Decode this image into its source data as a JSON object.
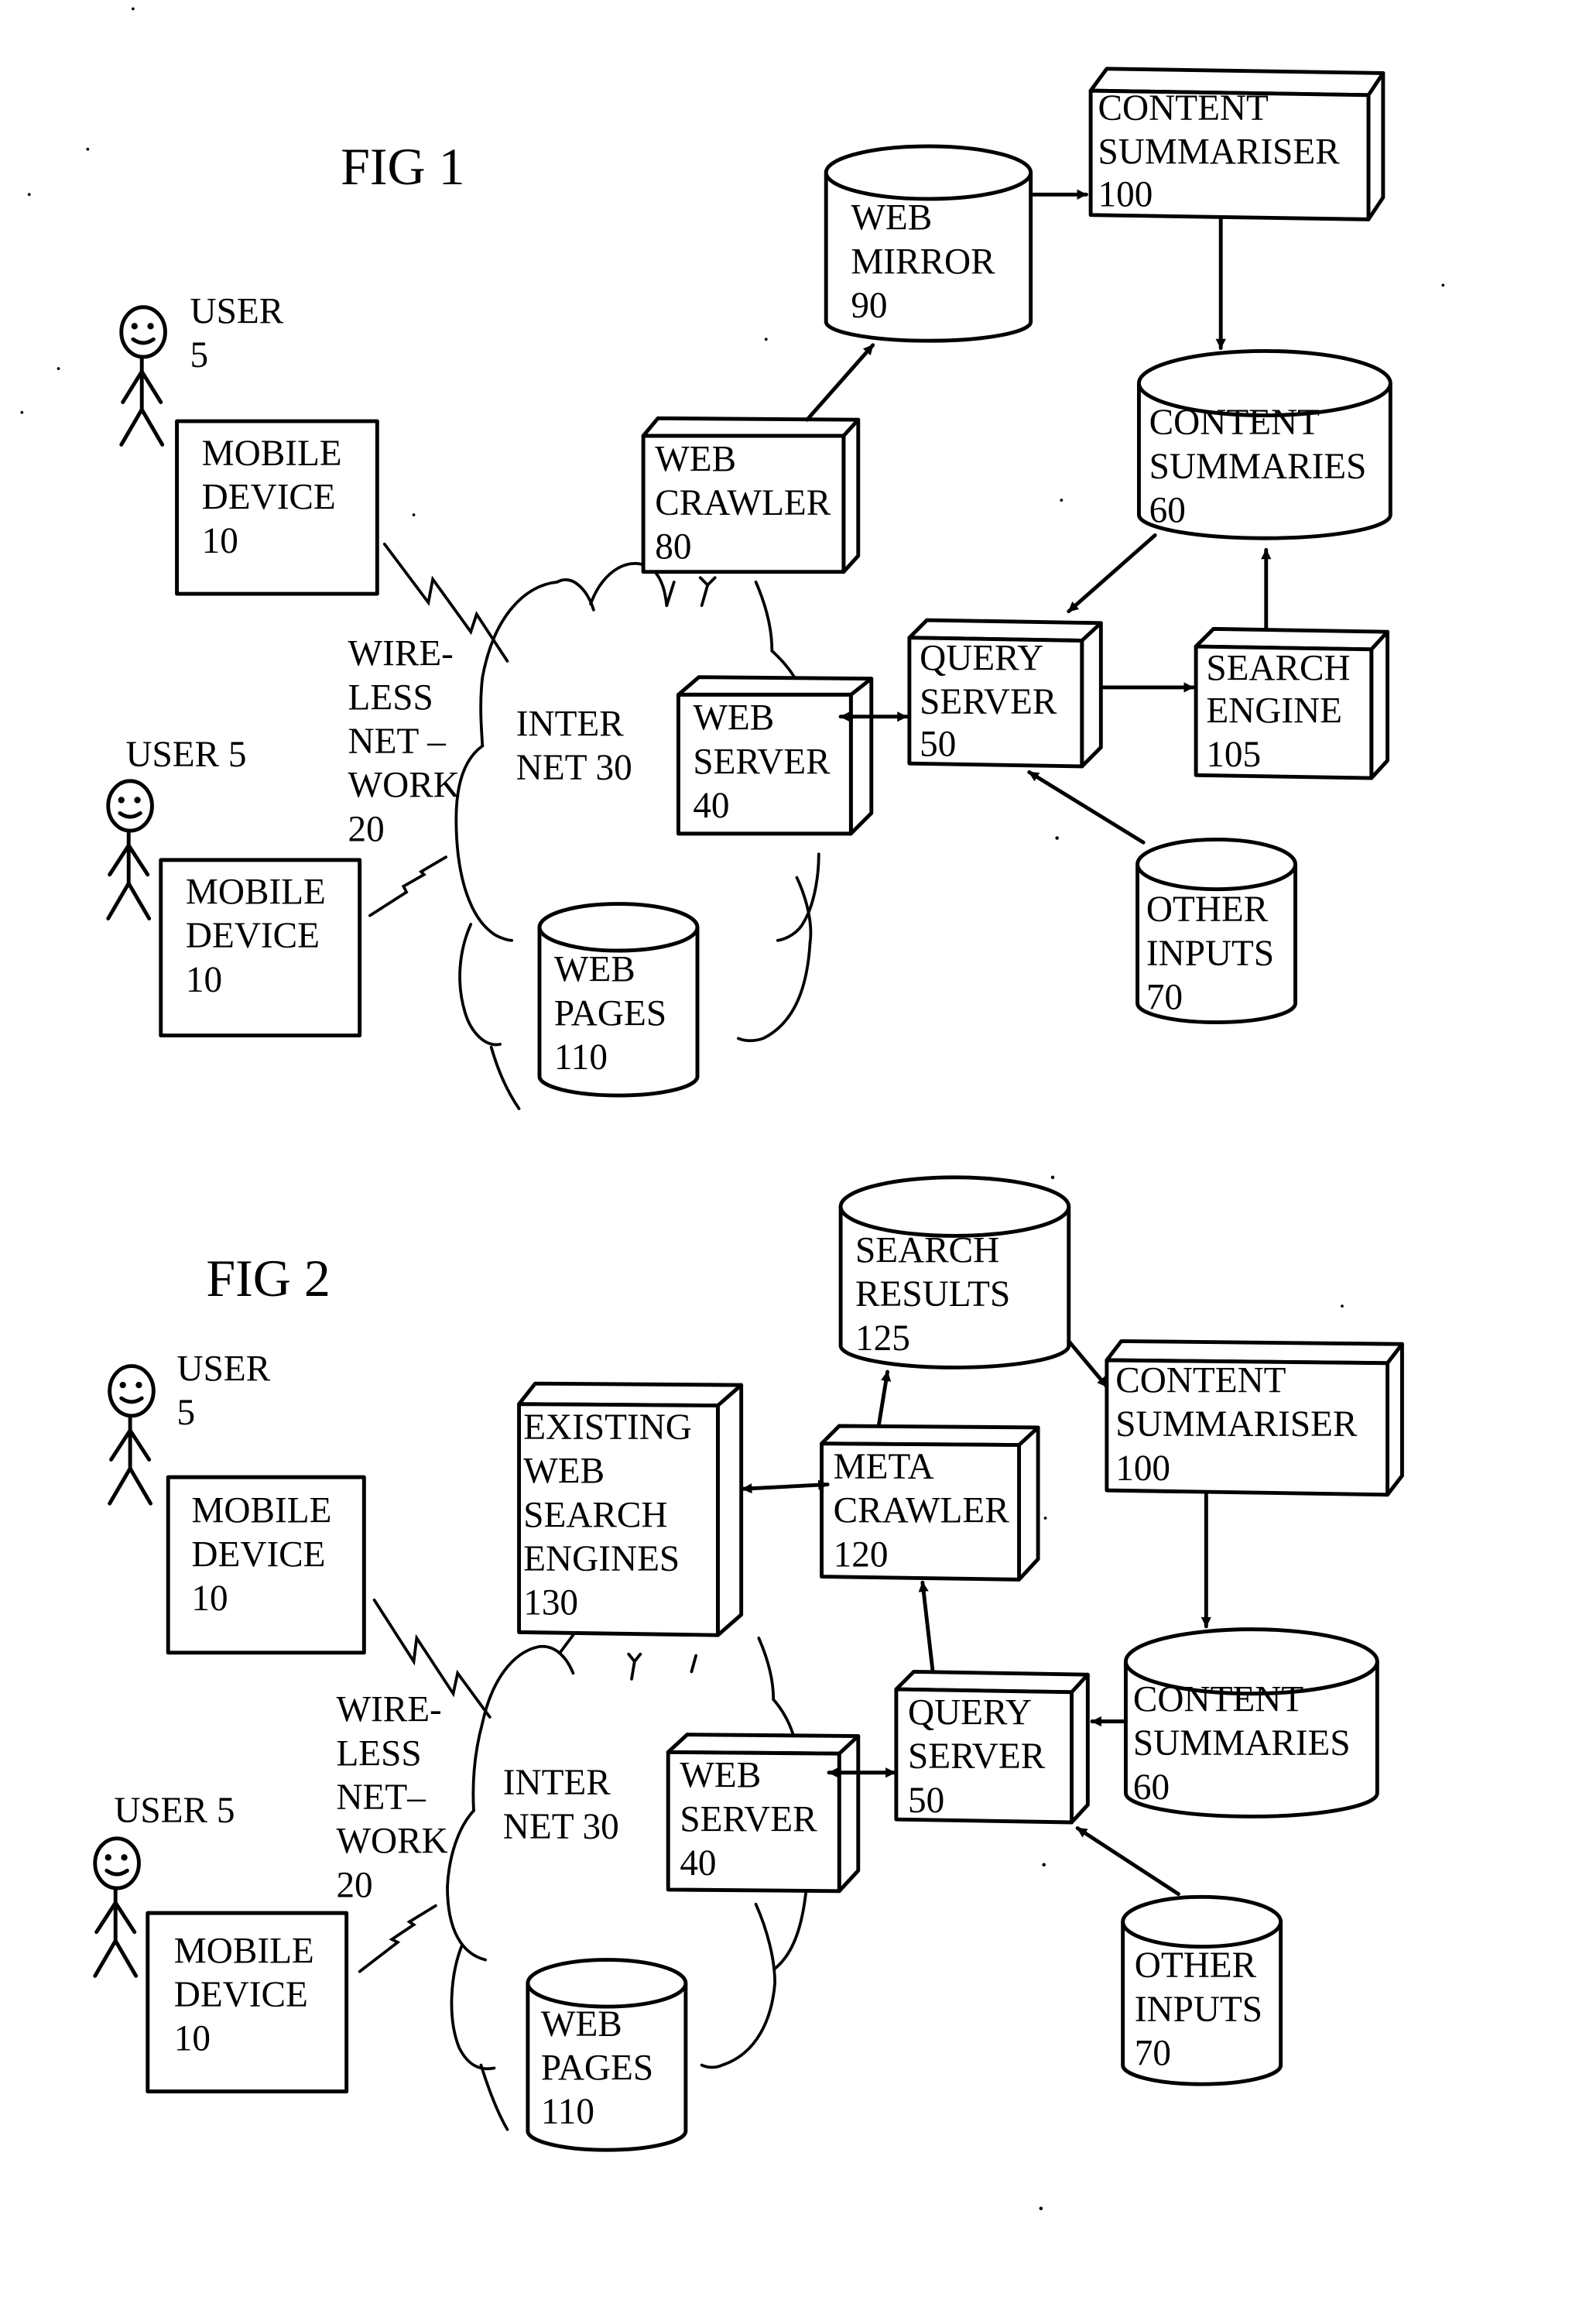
{
  "figures": [
    {
      "title": "FIG 1",
      "users": [
        {
          "label_lines": [
            "USER",
            "5"
          ]
        },
        {
          "label_lines": [
            "USER 5"
          ]
        }
      ],
      "mobile_devices": [
        {
          "label_lines": [
            "MOBILE",
            "DEVICE",
            "10"
          ]
        },
        {
          "label_lines": [
            "MOBILE",
            "DEVICE",
            "10"
          ]
        }
      ],
      "wireless_network": {
        "label_lines": [
          "WIRE-",
          "LESS",
          "NET –",
          "WORK",
          "20"
        ]
      },
      "internet": {
        "label_lines": [
          "INTER",
          "NET 30"
        ]
      },
      "web_server": {
        "label_lines": [
          "WEB",
          "SERVER",
          "40"
        ]
      },
      "web_pages": {
        "label_lines": [
          "WEB",
          "PAGES",
          "110"
        ]
      },
      "web_crawler": {
        "label_lines": [
          "WEB",
          "CRAWLER",
          "80"
        ]
      },
      "web_mirror": {
        "label_lines": [
          "WEB",
          "MIRROR",
          "90"
        ]
      },
      "content_summariser": {
        "label_lines": [
          "CONTENT",
          "SUMMARISER",
          "100"
        ]
      },
      "content_summaries": {
        "label_lines": [
          "CONTENT",
          "SUMMARIES",
          "60"
        ]
      },
      "query_server": {
        "label_lines": [
          "QUERY",
          "SERVER",
          "50"
        ]
      },
      "search_engine": {
        "label_lines": [
          "SEARCH",
          "ENGINE",
          "105"
        ]
      },
      "other_inputs": {
        "label_lines": [
          "OTHER",
          "INPUTS",
          "70"
        ]
      },
      "connections": [
        {
          "from": "WEB SERVER 40",
          "to": "QUERY SERVER 50",
          "direction": "bidirectional"
        },
        {
          "from": "WEB CRAWLER 80",
          "to": "WEB MIRROR 90",
          "direction": "forward"
        },
        {
          "from": "WEB MIRROR 90",
          "to": "CONTENT SUMMARISER 100",
          "direction": "forward"
        },
        {
          "from": "CONTENT SUMMARISER 100",
          "to": "CONTENT SUMMARIES 60",
          "direction": "forward"
        },
        {
          "from": "CONTENT SUMMARIES 60",
          "to": "QUERY SERVER 50",
          "direction": "forward"
        },
        {
          "from": "QUERY SERVER 50",
          "to": "SEARCH ENGINE 105",
          "direction": "forward"
        },
        {
          "from": "SEARCH ENGINE 105",
          "to": "CONTENT SUMMARIES 60",
          "direction": "forward"
        },
        {
          "from": "OTHER INPUTS 70",
          "to": "QUERY SERVER 50",
          "direction": "forward"
        },
        {
          "from": "MOBILE DEVICE 10",
          "to": "INTERNET 30",
          "direction": "wireless"
        },
        {
          "from": "MOBILE DEVICE 10",
          "to": "INTERNET 30",
          "direction": "wireless"
        }
      ]
    },
    {
      "title": "FIG 2",
      "users": [
        {
          "label_lines": [
            "USER",
            "5"
          ]
        },
        {
          "label_lines": [
            "USER 5"
          ]
        }
      ],
      "mobile_devices": [
        {
          "label_lines": [
            "MOBILE",
            "DEVICE",
            "10"
          ]
        },
        {
          "label_lines": [
            "MOBILE",
            "DEVICE",
            "10"
          ]
        }
      ],
      "wireless_network": {
        "label_lines": [
          "WIRE-",
          "LESS",
          "NET–",
          "WORK",
          "20"
        ]
      },
      "internet": {
        "label_lines": [
          "INTER",
          "NET 30"
        ]
      },
      "web_server": {
        "label_lines": [
          "WEB",
          "SERVER",
          "40"
        ]
      },
      "web_pages": {
        "label_lines": [
          "WEB",
          "PAGES",
          "110"
        ]
      },
      "existing_search_engines": {
        "label_lines": [
          "EXISTING",
          "WEB",
          "SEARCH",
          "ENGINES",
          "130"
        ]
      },
      "meta_crawler": {
        "label_lines": [
          "META",
          "CRAWLER",
          "120"
        ]
      },
      "search_results": {
        "label_lines": [
          "SEARCH",
          "RESULTS",
          "125"
        ]
      },
      "content_summariser": {
        "label_lines": [
          "CONTENT",
          "SUMMARISER",
          "100"
        ]
      },
      "content_summaries": {
        "label_lines": [
          "CONTENT",
          "SUMMARIES",
          "60"
        ]
      },
      "query_server": {
        "label_lines": [
          "QUERY",
          "SERVER",
          "50"
        ]
      },
      "other_inputs": {
        "label_lines": [
          "OTHER",
          "INPUTS",
          "70"
        ]
      },
      "connections": [
        {
          "from": "WEB SERVER 40",
          "to": "QUERY SERVER 50",
          "direction": "bidirectional"
        },
        {
          "from": "QUERY SERVER 50",
          "to": "META CRAWLER 120",
          "direction": "forward"
        },
        {
          "from": "EXISTING WEB SEARCH ENGINES 130",
          "to": "META CRAWLER 120",
          "direction": "bidirectional"
        },
        {
          "from": "META CRAWLER 120",
          "to": "SEARCH RESULTS 125",
          "direction": "forward"
        },
        {
          "from": "SEARCH RESULTS 125",
          "to": "CONTENT SUMMARISER 100",
          "direction": "forward"
        },
        {
          "from": "CONTENT SUMMARISER 100",
          "to": "CONTENT SUMMARIES 60",
          "direction": "forward"
        },
        {
          "from": "CONTENT SUMMARIES 60",
          "to": "QUERY SERVER 50",
          "direction": "forward"
        },
        {
          "from": "OTHER INPUTS 70",
          "to": "QUERY SERVER 50",
          "direction": "forward"
        },
        {
          "from": "MOBILE DEVICE 10",
          "to": "INTERNET 30",
          "direction": "wireless"
        },
        {
          "from": "MOBILE DEVICE 10",
          "to": "INTERNET 30",
          "direction": "wireless"
        }
      ]
    }
  ]
}
